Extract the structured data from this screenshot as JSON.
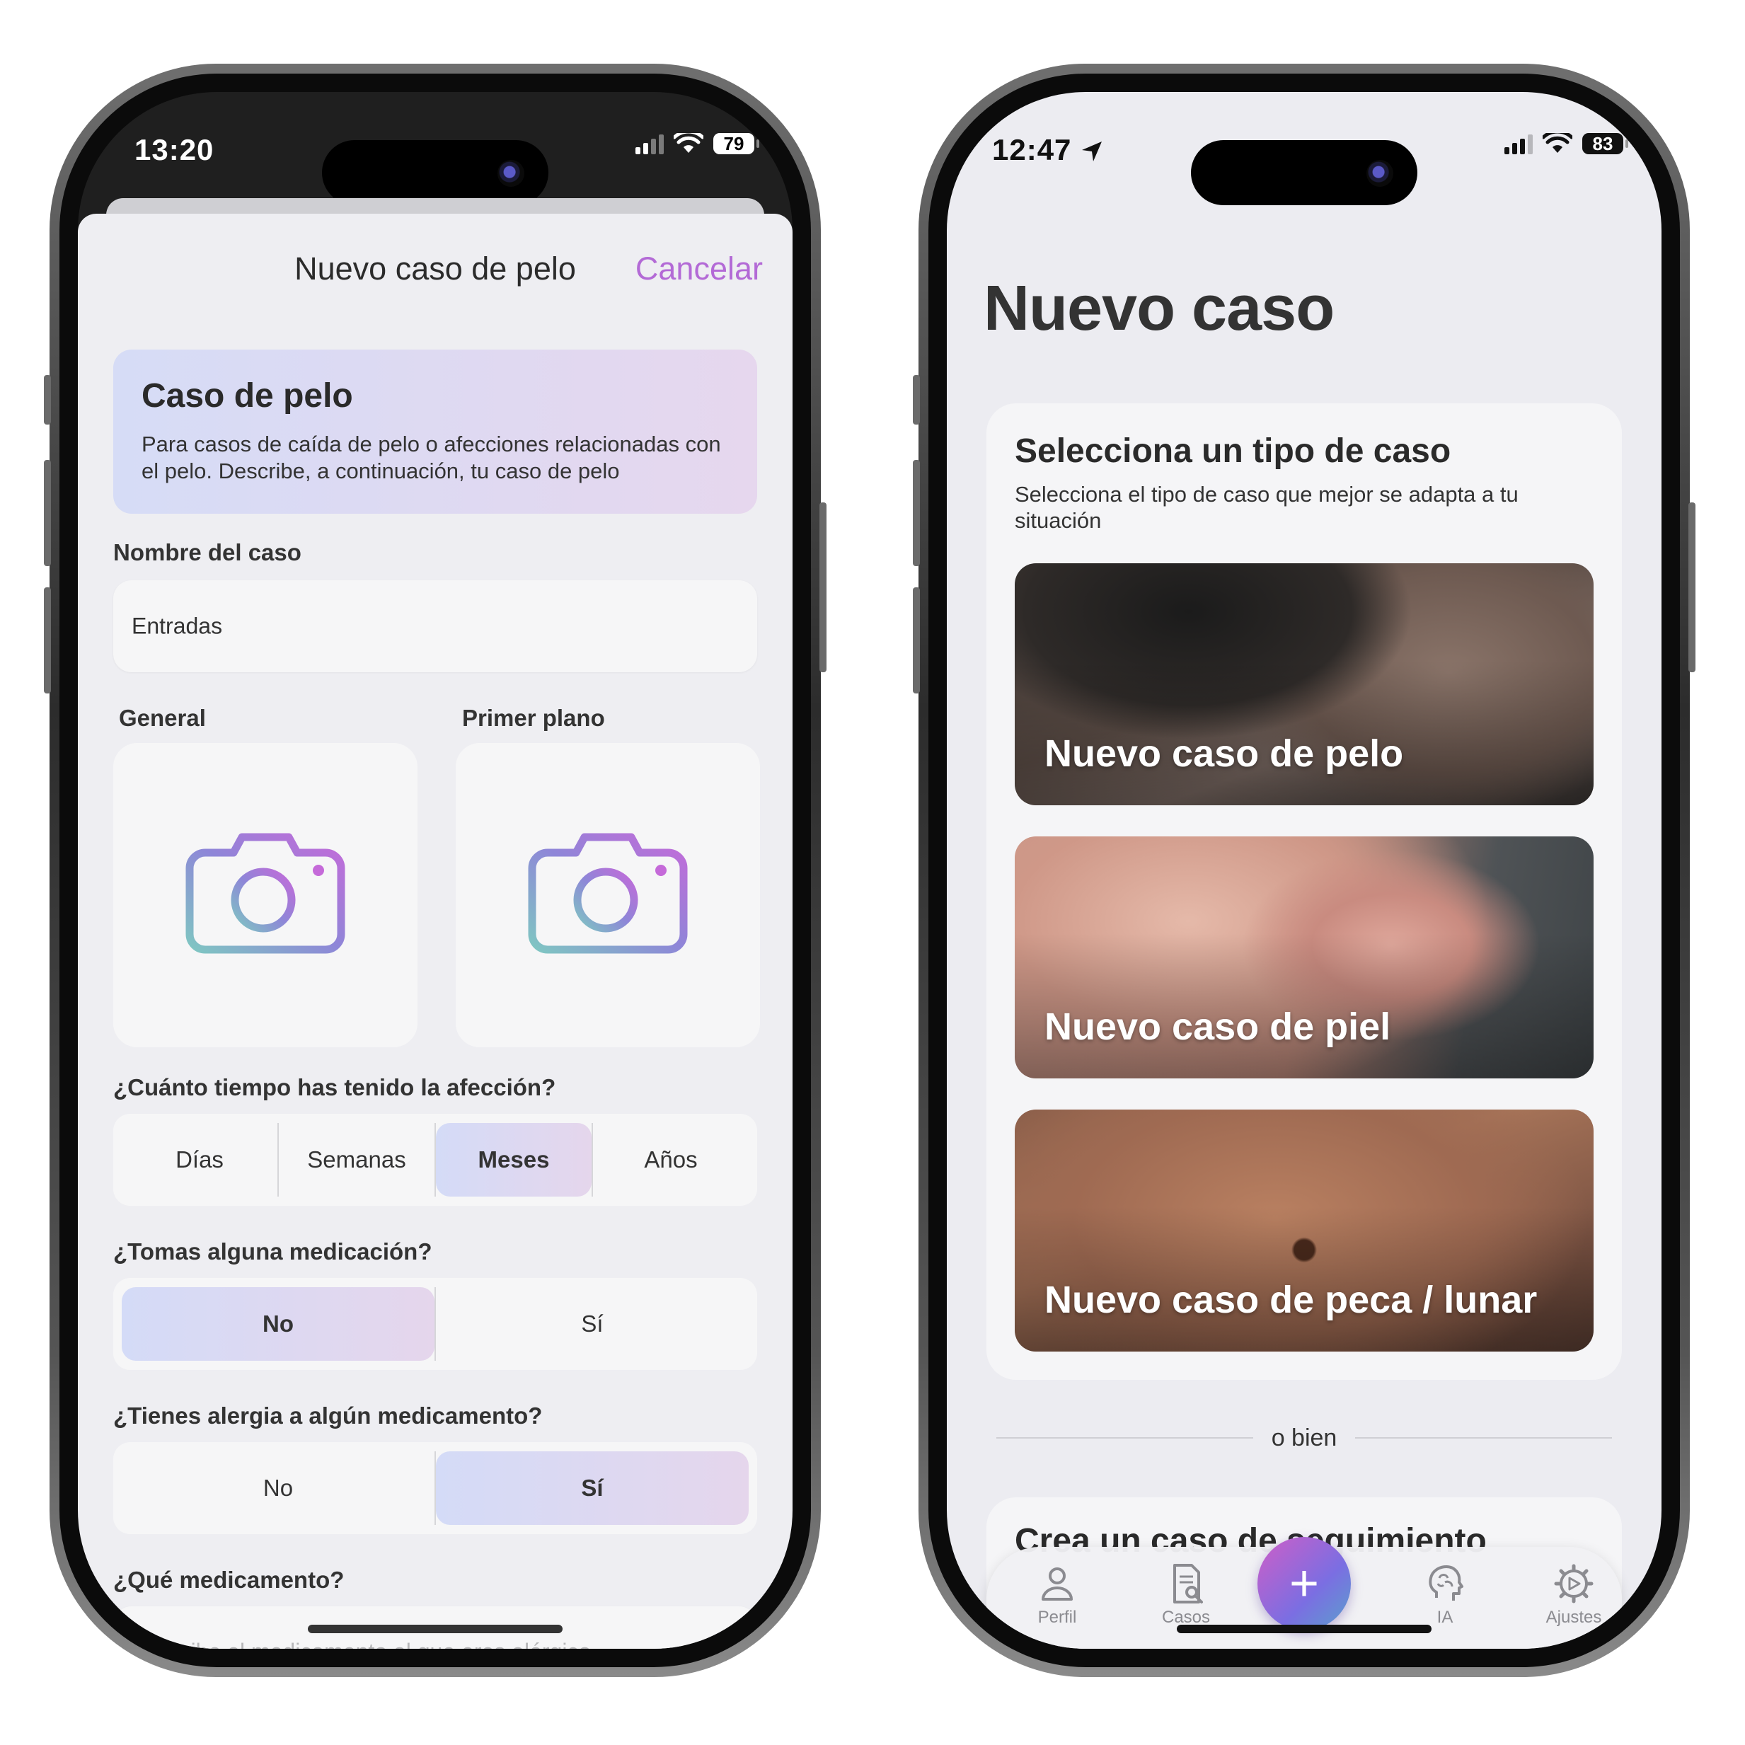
{
  "left": {
    "status": {
      "time": "13:20",
      "battery": "79"
    },
    "nav": {
      "title": "Nuevo caso de pelo",
      "cancel": "Cancelar"
    },
    "info": {
      "title": "Caso de pelo",
      "description": "Para casos de caída de pelo o afecciones relacionadas con el pelo. Describe, a continuación, tu caso de pelo"
    },
    "case_name": {
      "label": "Nombre del caso",
      "value": "Entradas"
    },
    "photos": {
      "general_label": "General",
      "closeup_label": "Primer plano"
    },
    "duration": {
      "question": "¿Cuánto tiempo has tenido la afección?",
      "options": [
        "Días",
        "Semanas",
        "Meses",
        "Años"
      ],
      "selected": "Meses"
    },
    "medication": {
      "question": "¿Tomas alguna medicación?",
      "options": [
        "No",
        "Sí"
      ],
      "selected": "No"
    },
    "allergy": {
      "question": "¿Tienes alergia a algún medicamento?",
      "options": [
        "No",
        "Sí"
      ],
      "selected": "Sí"
    },
    "which_med": {
      "question": "¿Qué medicamento?",
      "placeholder": "Describe el medicamento al que eres alérgico"
    }
  },
  "right": {
    "status": {
      "time": "12:47",
      "battery": "83"
    },
    "title": "Nuevo caso",
    "select_card": {
      "title": "Selecciona un tipo de caso",
      "subtitle": "Selecciona el tipo de caso que mejor se adapta a tu situación",
      "cases": [
        "Nuevo caso de pelo",
        "Nuevo caso de piel",
        "Nuevo caso de peca / lunar"
      ]
    },
    "divider": "o bien",
    "follow_card_title": "Crea un caso de seguimiento",
    "tabbar": {
      "items": [
        "Perfil",
        "Casos",
        "IA",
        "Ajustes"
      ],
      "fab": "+"
    }
  },
  "colors": {
    "accent": "#b36ad6",
    "selected_gradient_start": "#d4dbf7",
    "selected_gradient_end": "#e5d6ec",
    "fab_start": "#cf5ec7",
    "fab_end": "#5aa0cc"
  },
  "icons": [
    "camera-icon",
    "person-icon",
    "document-search-icon",
    "brain-icon",
    "gear-icon",
    "location-arrow-icon",
    "wifi-icon",
    "signal-icon",
    "battery-icon"
  ]
}
